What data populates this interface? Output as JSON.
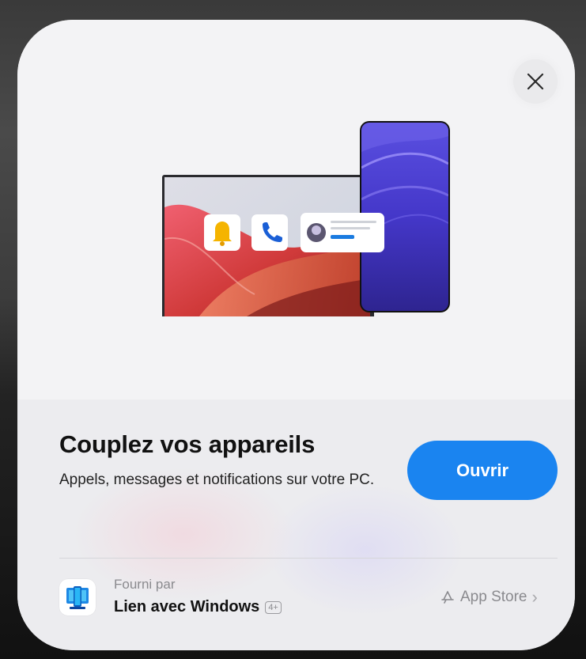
{
  "sheet": {
    "title": "Couplez vos appareils",
    "subtitle": "Appels, messages et notifications sur votre PC.",
    "open_label": "Ouvrir"
  },
  "provider": {
    "label": "Fourni par",
    "app_name": "Lien avec Windows",
    "age_rating": "4+",
    "store_label": "App Store",
    "store_chevron": "›"
  },
  "icons": [
    "close-icon",
    "bell-icon",
    "phone-call-icon",
    "avatar-icon",
    "app-store-icon",
    "phone-link-app-icon"
  ],
  "colors": {
    "accent": "#1a84f0",
    "notification_bell": "#f5b400",
    "phone_screen": "#4a3fd2"
  }
}
